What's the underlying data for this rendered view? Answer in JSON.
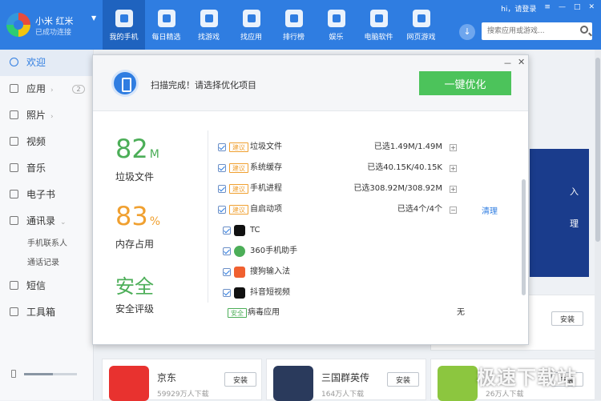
{
  "device": {
    "name": "小米 红米",
    "status": "已成功连接"
  },
  "nav": [
    {
      "label": "我的手机",
      "icon": "phone-icon"
    },
    {
      "label": "每日精选",
      "icon": "calendar-icon"
    },
    {
      "label": "找游戏",
      "icon": "gamepad-icon"
    },
    {
      "label": "找应用",
      "icon": "bag-icon"
    },
    {
      "label": "排行榜",
      "icon": "medal-icon"
    },
    {
      "label": "娱乐",
      "icon": "folder-icon"
    },
    {
      "label": "电脑软件",
      "icon": "monitor-icon"
    },
    {
      "label": "网页游戏",
      "icon": "web-game-icon"
    }
  ],
  "topbar": {
    "login": "hi，请登录",
    "menu": "≡",
    "min": "—",
    "max": "□",
    "close": "✕"
  },
  "search": {
    "placeholder": "搜索应用或游戏..."
  },
  "sidebar": {
    "items": [
      {
        "label": "欢迎"
      },
      {
        "label": "应用",
        "badge": "2"
      },
      {
        "label": "照片"
      },
      {
        "label": "视频"
      },
      {
        "label": "音乐"
      },
      {
        "label": "电子书"
      },
      {
        "label": "通讯录"
      },
      {
        "label": "短信"
      },
      {
        "label": "工具箱"
      }
    ],
    "contacts_sub": [
      "手机联系人",
      "通话记录"
    ]
  },
  "background": {
    "banner_text": [
      "入",
      "理"
    ],
    "cards": [
      {
        "title": "京东",
        "downloads": "59929万人下载",
        "install": "安装"
      },
      {
        "title": "三国群英传",
        "downloads": "164万人下载",
        "install": "安装"
      },
      {
        "title": "",
        "downloads": "26万人下载",
        "install": "安装"
      },
      {
        "install": "安装"
      }
    ]
  },
  "dialog": {
    "title": "扫描完成！请选择优化项目",
    "optimize_button": "一键优化",
    "min": "－",
    "close": "✕",
    "stats": [
      {
        "value": "82",
        "unit": "M",
        "label": "垃圾文件"
      },
      {
        "value": "83",
        "unit": "%",
        "label": "内存占用"
      },
      {
        "value": "安全",
        "unit": "",
        "label": "安全评级"
      }
    ],
    "tag_suggest": "建议",
    "tag_safe": "安全",
    "items": [
      {
        "name": "垃圾文件",
        "size": "已选1.49M/1.49M",
        "toggle": "+"
      },
      {
        "name": "系统缓存",
        "size": "已选40.15K/40.15K",
        "toggle": "+"
      },
      {
        "name": "手机进程",
        "size": "已选308.92M/308.92M",
        "toggle": "+"
      },
      {
        "name": "自启动项",
        "size": "已选4个/4个",
        "toggle": "−"
      }
    ],
    "clean_link": "清理",
    "apps": [
      {
        "name": "TC",
        "color": "#111111"
      },
      {
        "name": "360手机助手",
        "color": "#4cae58"
      },
      {
        "name": "搜狗输入法",
        "color": "#f06030"
      },
      {
        "name": "抖音短视频",
        "color": "#111111"
      }
    ],
    "virus": {
      "name": "病毒应用",
      "value": "无"
    }
  },
  "watermark": "极速下载站"
}
